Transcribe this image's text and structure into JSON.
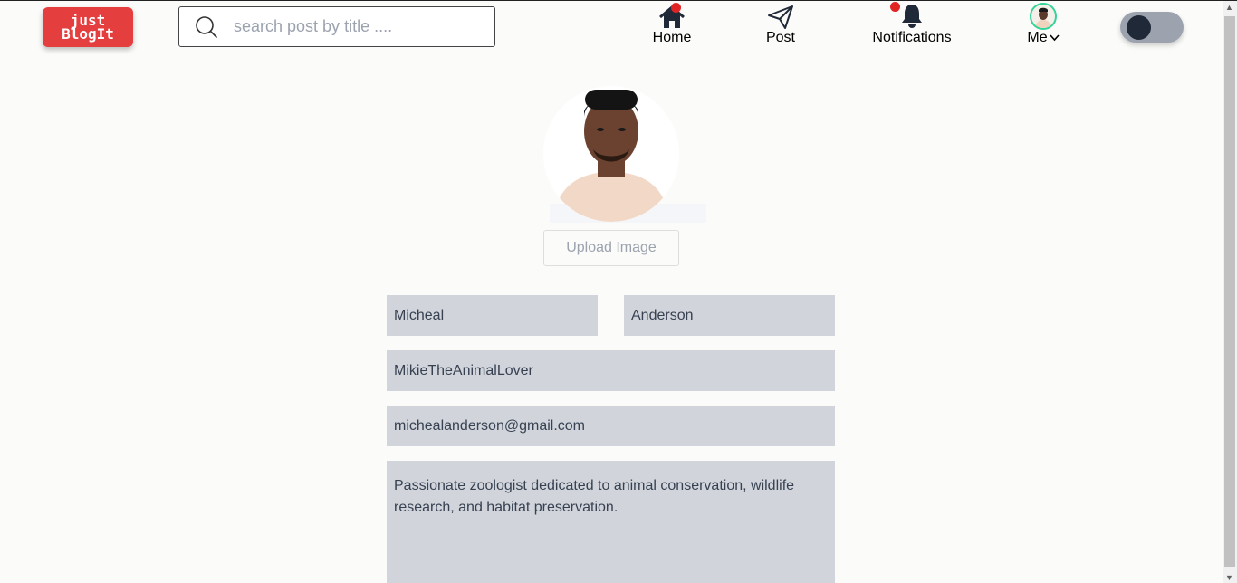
{
  "header": {
    "logo": {
      "line1": "just",
      "line2": "BlogIt"
    },
    "search": {
      "placeholder": "search post by title ...."
    },
    "nav": {
      "home": "Home",
      "post": "Post",
      "notifications": "Notifications",
      "me": "Me"
    },
    "theme_toggle": {
      "state": "off"
    }
  },
  "profile": {
    "upload_label": "Upload Image",
    "first_name": "Micheal",
    "last_name": "Anderson",
    "username": "MikieTheAnimalLover",
    "email": "michealanderson@gmail.com",
    "bio": "Passionate zoologist dedicated to animal conservation, wildlife research, and habitat preservation."
  },
  "colors": {
    "brand": "#e53e3e",
    "notification_dot": "#e02424",
    "input_bg": "#d1d5db",
    "avatar_ring": "#34d399"
  }
}
